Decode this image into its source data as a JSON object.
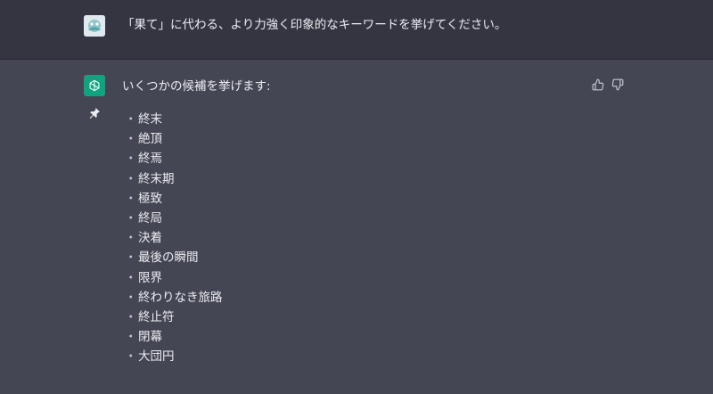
{
  "user_message": {
    "text": "「果て」に代わる、より力強く印象的なキーワードを挙げてください。",
    "avatar_icon": "user-avatar-icon"
  },
  "assistant_message": {
    "avatar_icon": "openai-logo-icon",
    "intro": "いくつかの候補を挙げます:",
    "bullet": "・",
    "items": [
      "終末",
      "絶頂",
      "終焉",
      "終末期",
      "極致",
      "終局",
      "決着",
      "最後の瞬間",
      "限界",
      "終わりなき旅路",
      "終止符",
      "閉幕",
      "大団円"
    ],
    "feedback_icons": [
      "thumbs-up-icon",
      "thumbs-down-icon"
    ],
    "pin_icon": "pin-icon"
  },
  "colors": {
    "user_bg": "#343541",
    "assistant_bg": "#444654",
    "brand": "#10a37f",
    "text": "#ececf1"
  }
}
